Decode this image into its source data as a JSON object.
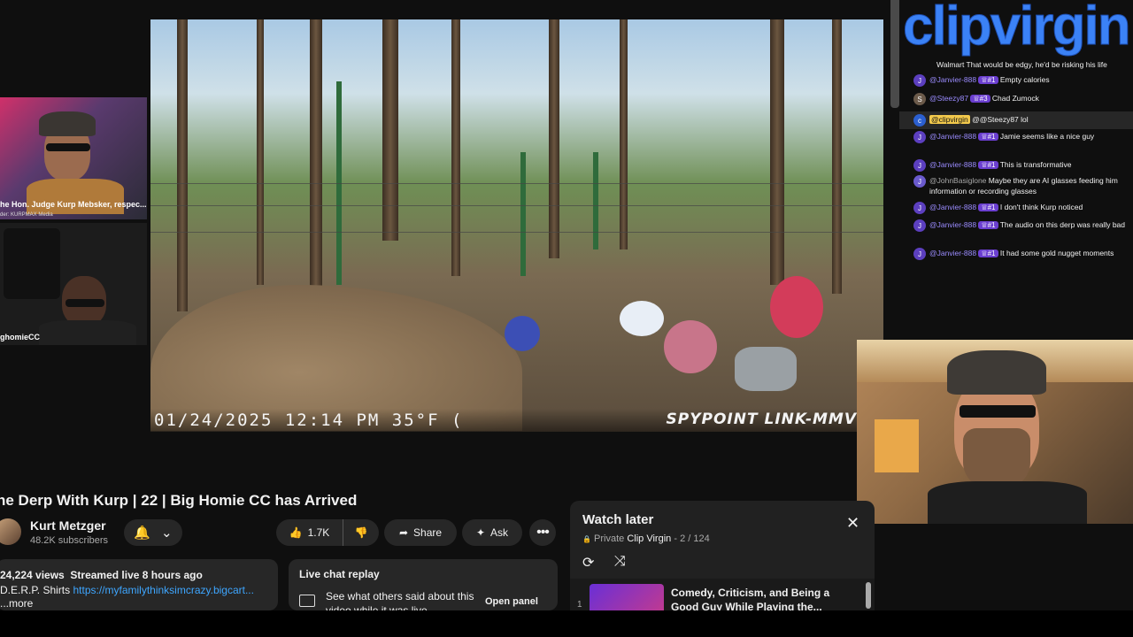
{
  "logo": "clipvirgin",
  "video": {
    "stamp_date": "01/24/2025  12:14 PM  35°F (",
    "stamp_brand": "SPYPOINT LINK-MMV"
  },
  "cams": {
    "cam1_label": "he Hon. Judge Kurp Mebsker, respec...",
    "cam1_sub": "der: KURPMAX Media",
    "cam2_label": "ghomieCC"
  },
  "chat": {
    "top_line": "Walmart That would be edgy, he'd be risking his life",
    "messages": [
      {
        "avatar": "J",
        "user": "@Janvier-888",
        "badge": "#1",
        "msg": "Empty calories"
      },
      {
        "avatar": "S",
        "user": "@Steezy87",
        "badge": "#3",
        "msg": "Chad Zumock"
      },
      {
        "avatar": "c",
        "user": "@clipvirgin",
        "badge": "",
        "msg": "@@Steezy87 lol"
      },
      {
        "avatar": "J",
        "user": "@Janvier-888",
        "badge": "#1",
        "msg": "Jamie seems like a nice guy"
      },
      {
        "avatar": "J",
        "user": "@Janvier-888",
        "badge": "#1",
        "msg": "This is transformative"
      },
      {
        "avatar": "J",
        "user": "@JohnBasiglone",
        "badge": "",
        "msg": "Maybe they are AI glasses feeding him information or recording glasses"
      },
      {
        "avatar": "J",
        "user": "@Janvier-888",
        "badge": "#1",
        "msg": "I don't think Kurp noticed"
      },
      {
        "avatar": "J",
        "user": "@Janvier-888",
        "badge": "#1",
        "msg": "The audio on this derp was really bad"
      },
      {
        "avatar": "J",
        "user": "@Janvier-888",
        "badge": "#1",
        "msg": "It had some gold nugget moments"
      }
    ]
  },
  "video_info": {
    "title": "he Derp With Kurp | 22 | Big Homie CC has Arrived",
    "channel": "Kurt Metzger",
    "subscribers": "48.2K subscribers",
    "likes": "1.7K",
    "share": "Share",
    "ask": "Ask",
    "more": "•••",
    "views": "24,224 views",
    "streamed": "Streamed live 8 hours ago",
    "desc_prefix": "D.E.R.P. Shirts",
    "desc_link": "https://myfamilythinksimcrazy.bigcart...",
    "desc_more": "...more"
  },
  "live_chat_replay": {
    "title": "Live chat replay",
    "text": "See what others said about this video while it was live.",
    "open": "Open panel"
  },
  "watch_later": {
    "title": "Watch later",
    "privacy": "Private",
    "owner": "Clip Virgin",
    "position": "- 2 / 124",
    "item_index": "1",
    "item_title": "Comedy, Criticism, and Being a Good Guy While Playing the..."
  },
  "icons": {
    "lock": "🔒",
    "close": "✕",
    "repeat": "⟳",
    "shuffle": "⤨",
    "bell": "🔔",
    "chevron": "⌄",
    "like": "👍",
    "dislike": "👎",
    "share": "➦",
    "ask": "✦"
  }
}
